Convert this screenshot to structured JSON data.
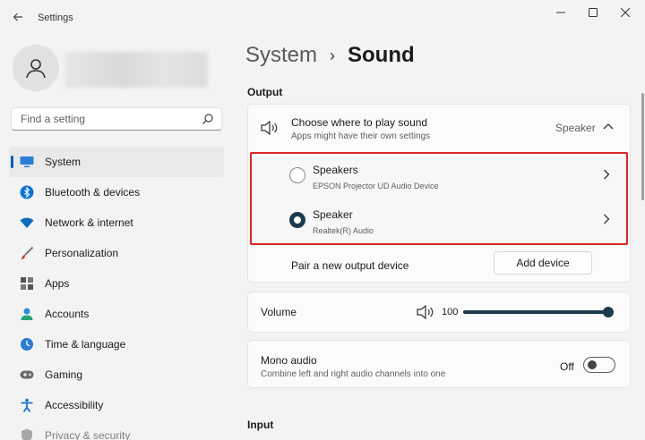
{
  "window": {
    "title": "Settings"
  },
  "search": {
    "placeholder": "Find a setting"
  },
  "sidebar": {
    "items": [
      {
        "label": "System",
        "icon": "system-icon",
        "color": "#2b7cd3"
      },
      {
        "label": "Bluetooth & devices",
        "icon": "bluetooth-icon",
        "color": "#0a74d6"
      },
      {
        "label": "Network & internet",
        "icon": "wifi-icon",
        "color": "#0f6cbd"
      },
      {
        "label": "Personalization",
        "icon": "brush-icon",
        "color": "#d13a3a"
      },
      {
        "label": "Apps",
        "icon": "apps-icon",
        "color": "#555555"
      },
      {
        "label": "Accounts",
        "icon": "accounts-icon",
        "color": "#2aa37a"
      },
      {
        "label": "Time & language",
        "icon": "globe-clock-icon",
        "color": "#2b7cd3"
      },
      {
        "label": "Gaming",
        "icon": "gamepad-icon",
        "color": "#6a6a6a"
      },
      {
        "label": "Accessibility",
        "icon": "accessibility-icon",
        "color": "#1a73c7"
      },
      {
        "label": "Privacy & security",
        "icon": "shield-icon",
        "color": "#6a6a6a"
      }
    ]
  },
  "breadcrumb": {
    "parent": "System",
    "separator": "›",
    "current": "Sound"
  },
  "output": {
    "section_label": "Output",
    "choose_title": "Choose where to play sound",
    "choose_subtitle": "Apps might have their own settings",
    "selected": "Speaker",
    "devices": [
      {
        "name": "Speakers",
        "desc": "EPSON Projector UD Audio Device",
        "selected": false
      },
      {
        "name": "Speaker",
        "desc": "Realtek(R) Audio",
        "selected": true
      }
    ],
    "pair_label": "Pair a new output device",
    "add_button": "Add device"
  },
  "volume": {
    "label": "Volume",
    "value": "100",
    "level": 1.0
  },
  "mono": {
    "title": "Mono audio",
    "subtitle": "Combine left and right audio channels into one",
    "state": "Off"
  },
  "input": {
    "section_label": "Input"
  },
  "colors": {
    "accent": "#1d3b4f",
    "highlight": "#d62828",
    "active_bar": "#005fb8"
  }
}
